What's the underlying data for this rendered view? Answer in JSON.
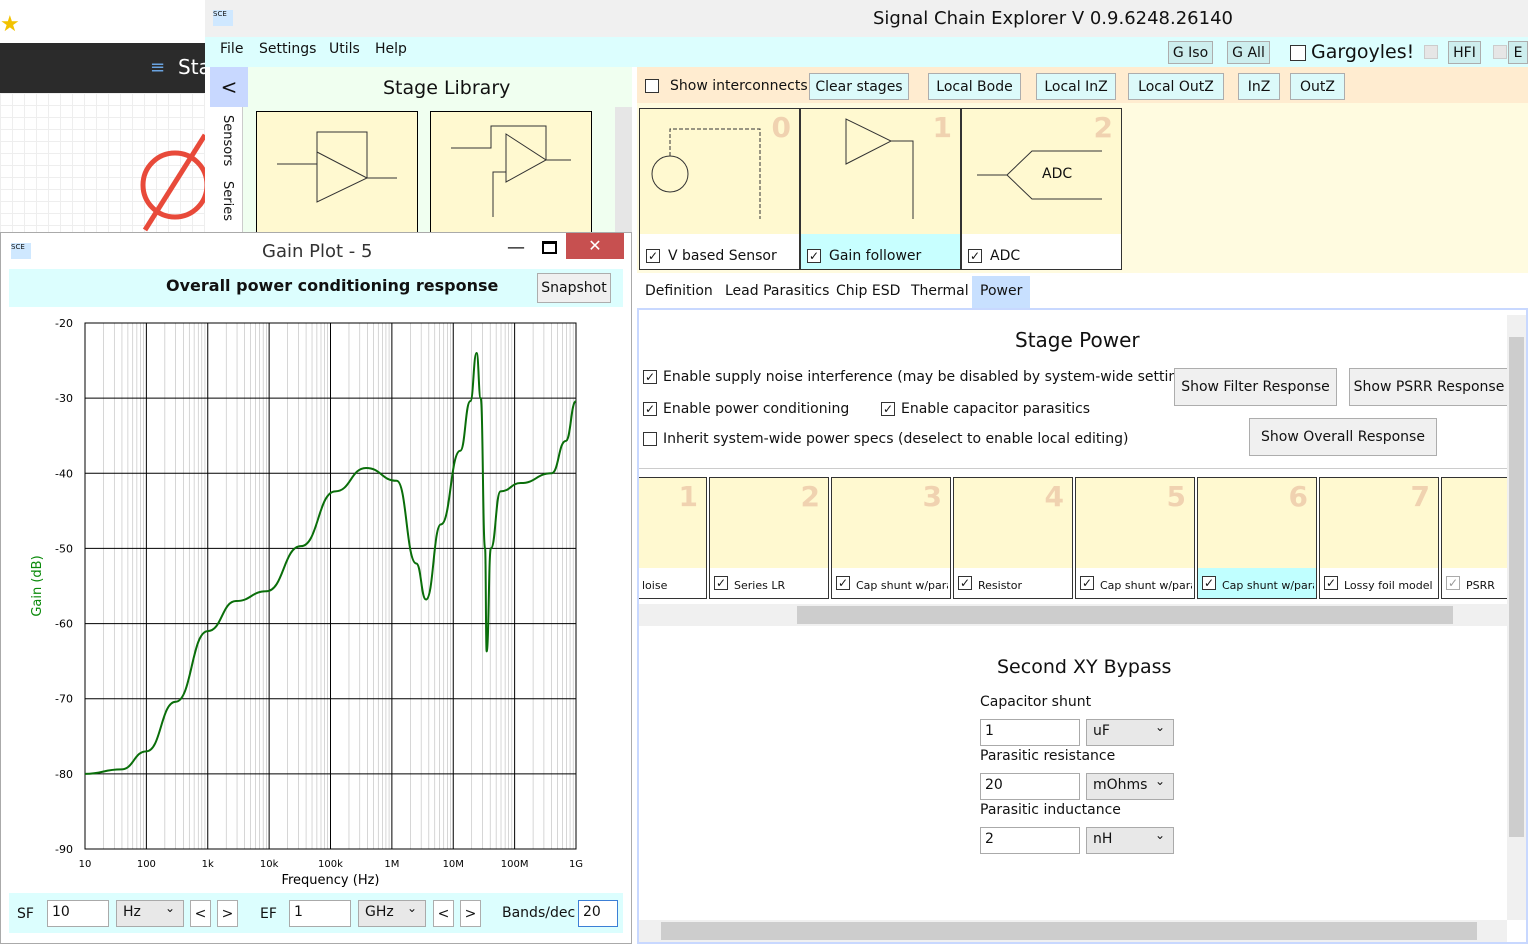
{
  "bg_app": {
    "title_fragment": "Sta"
  },
  "window": {
    "title": "Signal Chain Explorer V 0.9.6248.26140"
  },
  "menu": [
    "File",
    "Settings",
    "Utils",
    "Help"
  ],
  "menu_right": {
    "g_iso": "G Iso",
    "g_all": "G All",
    "gargoyles": "Gargoyles!",
    "gargoyles_checked": false,
    "hfi": "HFI",
    "e": "E"
  },
  "library": {
    "back": "<",
    "title": "Stage Library",
    "tabs": [
      "Sensors",
      "Series"
    ]
  },
  "toolbar": {
    "show_interconnects": "Show interconnects",
    "show_interconnects_checked": false,
    "buttons": [
      "Clear stages",
      "Local Bode",
      "Local InZ",
      "Local OutZ",
      "InZ",
      "OutZ"
    ]
  },
  "stages": [
    {
      "num": "0",
      "label": "V based Sensor",
      "checked": true
    },
    {
      "num": "1",
      "label": "Gain follower",
      "checked": true
    },
    {
      "num": "2",
      "label": "ADC",
      "checked": true,
      "inner": "ADC"
    }
  ],
  "tabs": [
    "Definition",
    "Lead Parasitics",
    "Chip ESD",
    "Thermal",
    "Power"
  ],
  "active_tab": "Power",
  "power": {
    "title": "Stage Power",
    "options": [
      {
        "label": "Enable supply noise interference (may be disabled by system-wide settings)",
        "checked": true
      },
      {
        "label": "Enable power conditioning",
        "checked": true
      },
      {
        "label": "Enable capacitor parasitics",
        "checked": true
      },
      {
        "label": "Inherit system-wide power specs (deselect to enable local editing)",
        "checked": false
      }
    ],
    "buttons": {
      "filter": "Show Filter Response",
      "psrr": "Show PSRR Response",
      "overall": "Show Overall Response"
    },
    "chain": [
      {
        "num": "1",
        "label": "loise"
      },
      {
        "num": "2",
        "label": "Series LR"
      },
      {
        "num": "3",
        "label": "Cap shunt w/paras"
      },
      {
        "num": "4",
        "label": "Resistor"
      },
      {
        "num": "5",
        "label": "Cap shunt w/paras"
      },
      {
        "num": "6",
        "label": "Cap shunt w/paras",
        "selected": true
      },
      {
        "num": "7",
        "label": "Lossy foil model"
      },
      {
        "num": "",
        "label": "PSRR"
      }
    ],
    "section_title": "Second XY Bypass",
    "fields": [
      {
        "label": "Capacitor shunt",
        "value": "1",
        "unit": "uF"
      },
      {
        "label": "Parasitic resistance",
        "value": "20",
        "unit": "mOhms"
      },
      {
        "label": "Parasitic inductance",
        "value": "2",
        "unit": "nH"
      }
    ]
  },
  "gain_plot": {
    "window_title": "Gain Plot - 5",
    "heading": "Overall power conditioning response",
    "snapshot": "Snapshot",
    "controls": {
      "sf_label": "SF",
      "sf_value": "10",
      "sf_unit": "Hz",
      "ef_label": "EF",
      "ef_value": "1",
      "ef_unit": "GHz",
      "prev": "<",
      "next": ">",
      "bands_label": "Bands/dec",
      "bands_value": "20"
    }
  },
  "chart_data": {
    "type": "line",
    "xlabel": "Frequency (Hz)",
    "ylabel": "Gain (dB)",
    "xscale": "log",
    "xlim": [
      10,
      1000000000
    ],
    "ylim": [
      -90,
      -20
    ],
    "xticks": [
      10,
      100,
      1000,
      10000,
      100000,
      1000000,
      10000000,
      100000000,
      1000000000
    ],
    "xtick_labels": [
      "10",
      "100",
      "1k",
      "10k",
      "100k",
      "1M",
      "10M",
      "100M",
      "1G"
    ],
    "yticks": [
      -20,
      -30,
      -40,
      -50,
      -60,
      -70,
      -80,
      -90
    ],
    "grid": true,
    "color": "#0a6e0a",
    "x": [
      10,
      39,
      100,
      300,
      1000,
      2900,
      9000,
      33000,
      120000,
      380000,
      1200000,
      2500000,
      3600000,
      6300000,
      13000000,
      19000000,
      24000000,
      28000000,
      33000000,
      35000000,
      41000000,
      59000000,
      126000000,
      400000000,
      680000000,
      1000000000
    ],
    "y": [
      -80,
      -79.4,
      -77,
      -70.4,
      -61,
      -57,
      -55.7,
      -49.7,
      -42.4,
      -39.3,
      -41,
      -52,
      -56.8,
      -46.8,
      -37,
      -30.4,
      -24,
      -30,
      -50,
      -63.7,
      -50,
      -42.4,
      -41.3,
      -40,
      -35.7,
      -30.4
    ]
  }
}
